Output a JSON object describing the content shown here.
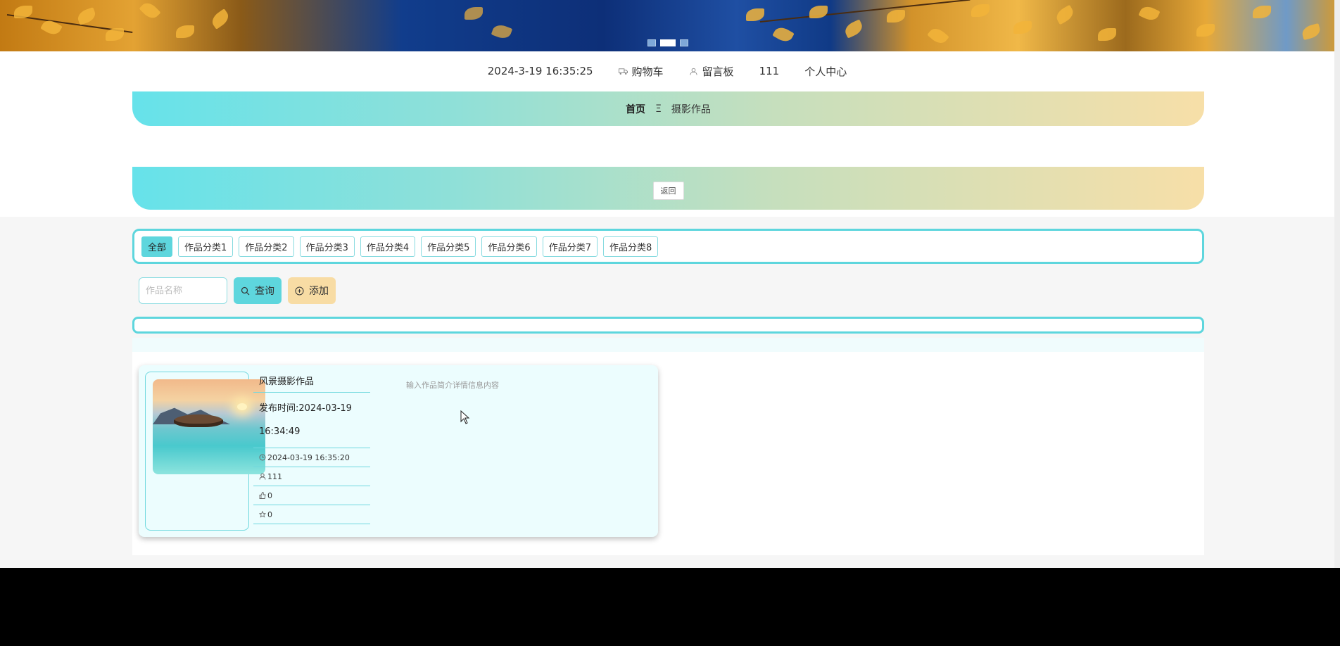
{
  "banner": {
    "slides": 3,
    "active_slide": 2
  },
  "topnav": {
    "datetime": "2024-3-19 16:35:25",
    "cart": "购物车",
    "message_board": "留言板",
    "username": "111",
    "profile": "个人中心"
  },
  "breadcrumb": {
    "home": "首页",
    "separator": "Ξ",
    "current": "摄影作品"
  },
  "back_button": "返回",
  "categories": {
    "active": "全部",
    "items": [
      "作品分类1",
      "作品分类2",
      "作品分类3",
      "作品分类4",
      "作品分类5",
      "作品分类6",
      "作品分类7",
      "作品分类8"
    ]
  },
  "search": {
    "placeholder": "作品名称",
    "query_label": "查询",
    "add_label": "添加"
  },
  "card": {
    "title": "风景摄影作品",
    "publish_date": "发布时间:2024-03-19 16:34:49",
    "timestamp": "2024-03-19 16:35:20",
    "author": "111",
    "likes": "0",
    "favorites": "0",
    "description": "输入作品简介详情信息内容"
  },
  "colors": {
    "accent": "#5ed6dd",
    "add_button": "#f8dca4",
    "card_bg": "#ecfdfe"
  }
}
